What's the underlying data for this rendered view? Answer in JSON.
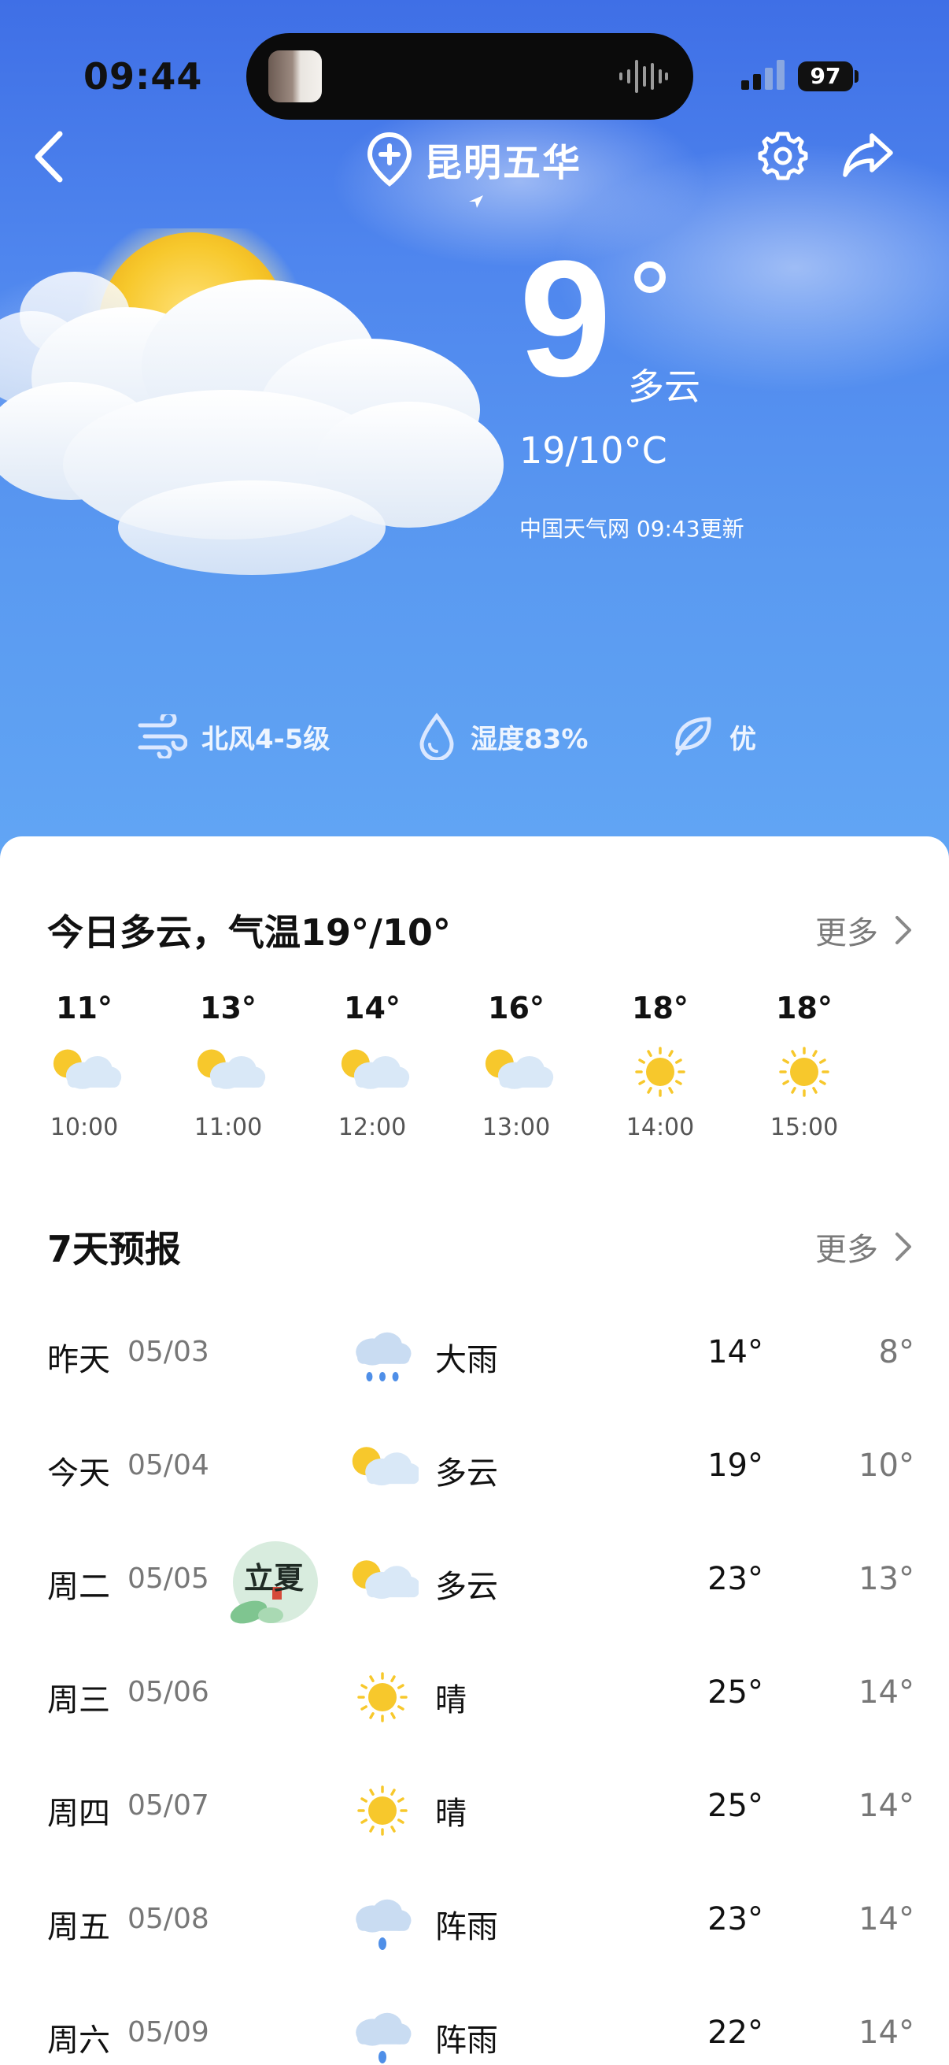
{
  "status_bar": {
    "time": "09:44",
    "battery": "97"
  },
  "header": {
    "location": "昆明五华"
  },
  "current": {
    "temp": "9",
    "condition": "多云",
    "hi_lo": "19/10°C",
    "updated": "中国天气网 09:43更新"
  },
  "indicators": {
    "wind": "北风4-5级",
    "humidity": "湿度83%",
    "air": "优"
  },
  "today": {
    "title": "今日多云，气温19°/10°",
    "more": "更多",
    "hours": [
      {
        "temp": "11°",
        "time": "10:00",
        "icon": "partly-cloudy-icon"
      },
      {
        "temp": "13°",
        "time": "11:00",
        "icon": "partly-cloudy-icon"
      },
      {
        "temp": "14°",
        "time": "12:00",
        "icon": "partly-cloudy-icon"
      },
      {
        "temp": "16°",
        "time": "13:00",
        "icon": "partly-cloudy-icon"
      },
      {
        "temp": "18°",
        "time": "14:00",
        "icon": "sunny-icon"
      },
      {
        "temp": "18°",
        "time": "15:00",
        "icon": "sunny-icon"
      }
    ]
  },
  "forecast": {
    "title": "7天预报",
    "more": "更多",
    "days": [
      {
        "name": "昨天",
        "date": "05/03",
        "cond": "大雨",
        "high": "14°",
        "low": "8°",
        "icon": "heavy-rain-icon"
      },
      {
        "name": "今天",
        "date": "05/04",
        "cond": "多云",
        "high": "19°",
        "low": "10°",
        "icon": "partly-cloudy-icon"
      },
      {
        "name": "周二",
        "date": "05/05",
        "cond": "多云",
        "high": "23°",
        "low": "13°",
        "icon": "partly-cloudy-icon"
      },
      {
        "name": "周三",
        "date": "05/06",
        "cond": "晴",
        "high": "25°",
        "low": "14°",
        "icon": "sunny-icon"
      },
      {
        "name": "周四",
        "date": "05/07",
        "cond": "晴",
        "high": "25°",
        "low": "14°",
        "icon": "sunny-icon"
      },
      {
        "name": "周五",
        "date": "05/08",
        "cond": "阵雨",
        "high": "23°",
        "low": "14°",
        "icon": "shower-icon"
      },
      {
        "name": "周六",
        "date": "05/09",
        "cond": "阵雨",
        "high": "22°",
        "low": "14°",
        "icon": "shower-icon"
      }
    ]
  },
  "solar_term_badge": "立夏",
  "colors": {
    "sky_top": "#3f6fe6",
    "sky_bottom": "#62a6f4",
    "sun": "#f7c82c"
  }
}
